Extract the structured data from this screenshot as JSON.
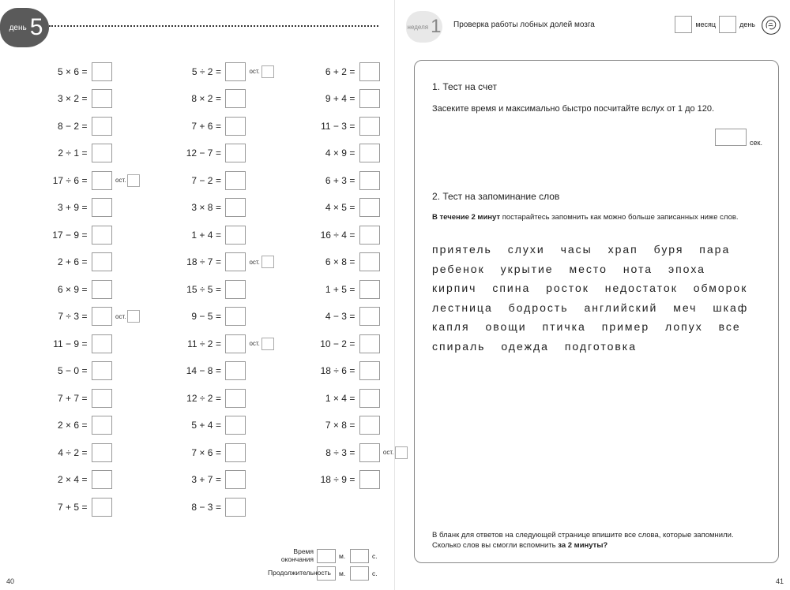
{
  "left": {
    "day_label": "день",
    "day_number": "5",
    "columns": [
      [
        {
          "expr": "5 × 6",
          "rem": false
        },
        {
          "expr": "3 × 2",
          "rem": false
        },
        {
          "expr": "8 − 2",
          "rem": false
        },
        {
          "expr": "2 ÷ 1",
          "rem": false
        },
        {
          "expr": "17 ÷ 6",
          "rem": true
        },
        {
          "expr": "3 + 9",
          "rem": false
        },
        {
          "expr": "17 − 9",
          "rem": false
        },
        {
          "expr": "2 + 6",
          "rem": false
        },
        {
          "expr": "6 × 9",
          "rem": false
        },
        {
          "expr": "7 ÷ 3",
          "rem": true
        },
        {
          "expr": "11 − 9",
          "rem": false
        },
        {
          "expr": "5 − 0",
          "rem": false
        },
        {
          "expr": "7 + 7",
          "rem": false
        },
        {
          "expr": "2 × 6",
          "rem": false
        },
        {
          "expr": "4 ÷ 2",
          "rem": false
        },
        {
          "expr": "2 × 4",
          "rem": false
        },
        {
          "expr": "7 + 5",
          "rem": false
        }
      ],
      [
        {
          "expr": "5 ÷ 2",
          "rem": true
        },
        {
          "expr": "8 × 2",
          "rem": false
        },
        {
          "expr": "7 + 6",
          "rem": false
        },
        {
          "expr": "12 − 7",
          "rem": false
        },
        {
          "expr": "7 − 2",
          "rem": false
        },
        {
          "expr": "3 × 8",
          "rem": false
        },
        {
          "expr": "1 + 4",
          "rem": false
        },
        {
          "expr": "18 ÷ 7",
          "rem": true
        },
        {
          "expr": "15 ÷ 5",
          "rem": false
        },
        {
          "expr": "9 − 5",
          "rem": false
        },
        {
          "expr": "11 ÷ 2",
          "rem": true
        },
        {
          "expr": "14 − 8",
          "rem": false
        },
        {
          "expr": "12 ÷ 2",
          "rem": false
        },
        {
          "expr": "5 + 4",
          "rem": false
        },
        {
          "expr": "7 × 6",
          "rem": false
        },
        {
          "expr": "3 + 7",
          "rem": false
        },
        {
          "expr": "8 − 3",
          "rem": false
        }
      ],
      [
        {
          "expr": "6 + 2",
          "rem": false
        },
        {
          "expr": "9 + 4",
          "rem": false
        },
        {
          "expr": "11 − 3",
          "rem": false
        },
        {
          "expr": "4 × 9",
          "rem": false
        },
        {
          "expr": "6 + 3",
          "rem": false
        },
        {
          "expr": "4 × 5",
          "rem": false
        },
        {
          "expr": "16 ÷ 4",
          "rem": false
        },
        {
          "expr": "6 × 8",
          "rem": false
        },
        {
          "expr": "1 + 5",
          "rem": false
        },
        {
          "expr": "4 − 3",
          "rem": false
        },
        {
          "expr": "10 − 2",
          "rem": false
        },
        {
          "expr": "18 ÷ 6",
          "rem": false
        },
        {
          "expr": "1 × 4",
          "rem": false
        },
        {
          "expr": "7 × 8",
          "rem": false
        },
        {
          "expr": "8 ÷ 3",
          "rem": true
        },
        {
          "expr": "18 ÷ 9",
          "rem": false
        }
      ]
    ],
    "eq": "=",
    "rem_label": "ост.",
    "timing1_label": "Время окончания",
    "timing2_label": "Продолжительность",
    "unit_min": "м.",
    "unit_sec": "с.",
    "page_number": "40"
  },
  "right": {
    "week_label": "неделя",
    "week_number": "1",
    "check_title": "Проверка работы лобных долей мозга",
    "month_label": "месяц",
    "day_label": "день",
    "sect1_title": "1. Тест на счет",
    "sect1_body": "Засеките время и максимально быстро посчитайте вслух от 1 до 120.",
    "sec_unit": "сек.",
    "sect2_title": "2. Тест на запоминание слов",
    "sect2_sub_a": "В течение 2 минут",
    "sect2_sub_b": " постарайтесь запомнить как можно больше записанных ниже слов.",
    "words": "приятель слухи часы храп буря пара ребенок укрытие место нота эпоха кирпич спина росток недостаток обморок лестница бодрость английский меч шкаф капля овощи птичка пример лопух все спираль одежда подготовка",
    "bottom_a": "В бланк для ответов на следующей странице впишите все слова, которые запомнили. Сколько слов вы смогли вспомнить ",
    "bottom_b": "за 2 минуты?",
    "page_number": "41"
  }
}
